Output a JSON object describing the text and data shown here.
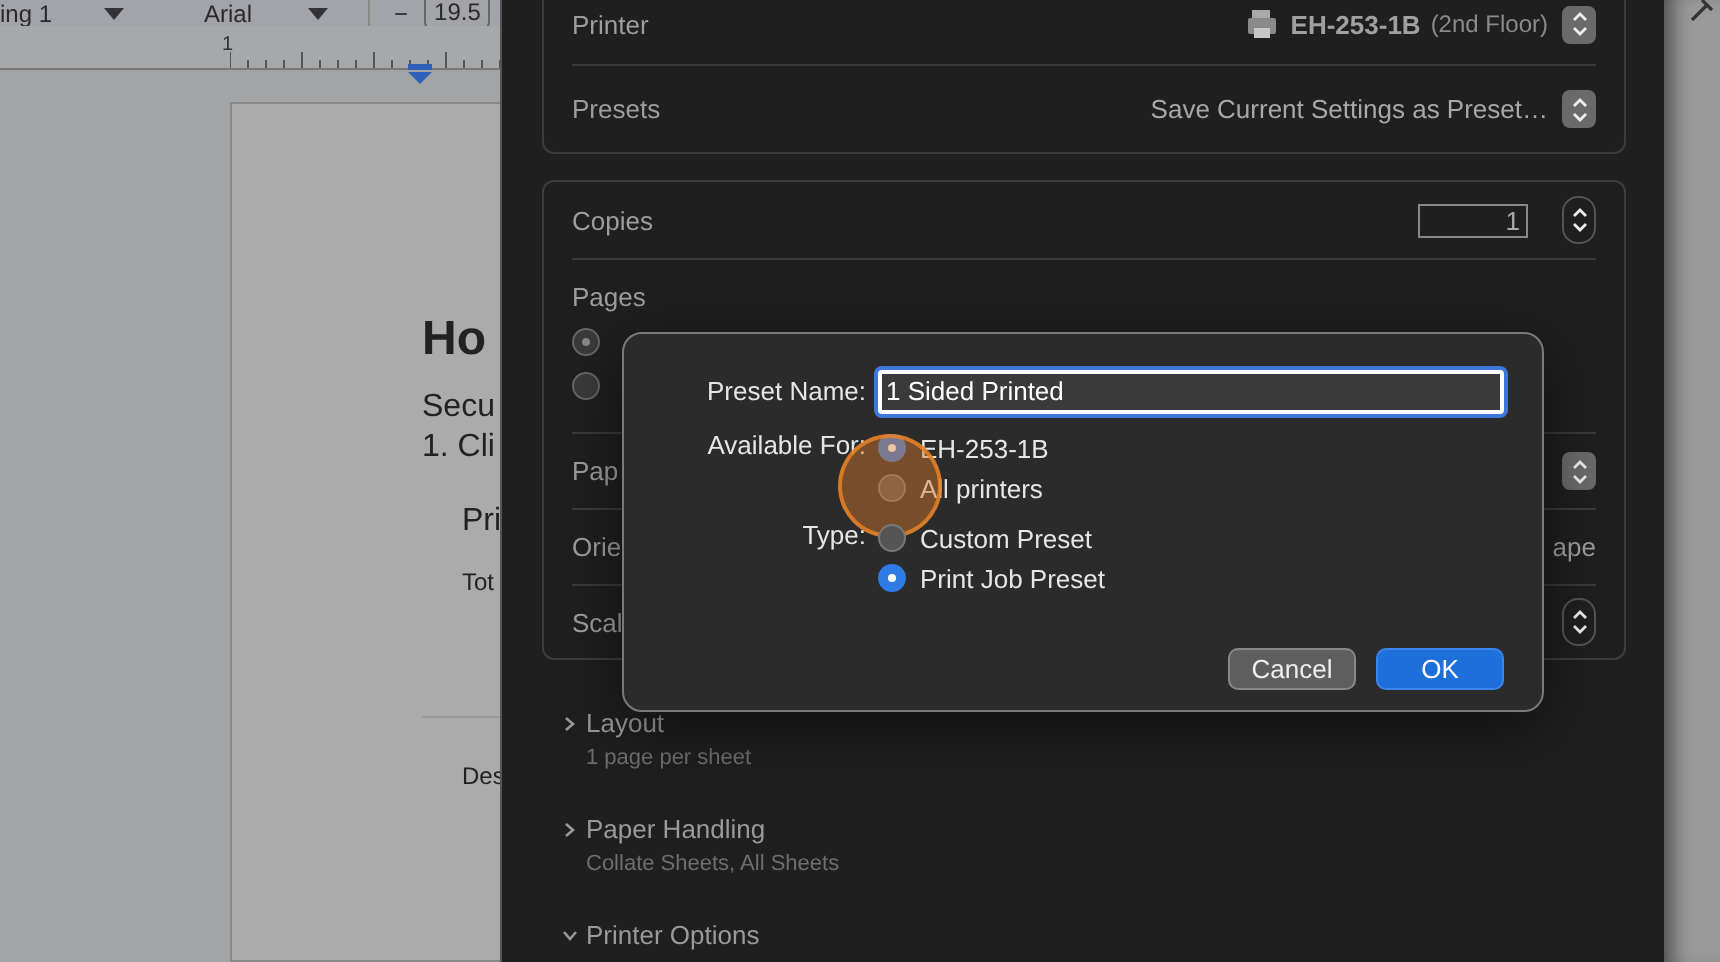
{
  "document": {
    "toolbar": {
      "style": "ing 1",
      "font": "Arial",
      "decrease": "−",
      "size": "19.5"
    },
    "ruler": {
      "mark": "1"
    },
    "texts": [
      {
        "kind": "heading",
        "text": "Ho"
      },
      {
        "kind": "body",
        "text": "Secu"
      },
      {
        "kind": "body",
        "text": "1. Cli"
      },
      {
        "kind": "subheading",
        "text": "Pri"
      },
      {
        "kind": "small",
        "text": "Tot"
      },
      {
        "kind": "rule"
      },
      {
        "kind": "small",
        "text": "Des"
      }
    ]
  },
  "print_sheet": {
    "printer": {
      "label": "Printer",
      "name": "EH-253-1B",
      "location": "(2nd Floor)"
    },
    "presets": {
      "label": "Presets",
      "value": "Save Current Settings as Preset…"
    },
    "copies": {
      "label": "Copies",
      "value": "1"
    },
    "pages": {
      "label": "Pages",
      "options": [
        {
          "selected": true
        },
        {
          "selected": false
        }
      ]
    },
    "rows": [
      {
        "kind": "popup",
        "label": "Pap"
      },
      {
        "kind": "text",
        "label": "Orie",
        "value": "ape"
      },
      {
        "kind": "stepper",
        "label": "Scal"
      }
    ],
    "sections": [
      {
        "title": "Layout",
        "summary": "1 page per sheet",
        "expanded": false
      },
      {
        "title": "Paper Handling",
        "summary": "Collate Sheets, All Sheets",
        "expanded": false
      },
      {
        "title": "Printer Options",
        "expanded": true
      }
    ]
  },
  "preset_dialog": {
    "name_label": "Preset Name:",
    "name_value": "1 Sided Printed",
    "available_label": "Available For:",
    "available_options": [
      {
        "label": "EH-253-1B",
        "selected": true,
        "highlighted": false
      },
      {
        "label": "All printers",
        "selected": false,
        "highlighted": true
      }
    ],
    "type_label": "Type:",
    "type_options": [
      {
        "label": "Custom Preset",
        "selected": false,
        "highlighted": false
      },
      {
        "label": "Print Job Preset",
        "selected": true,
        "highlighted": false
      }
    ],
    "buttons": [
      {
        "label": "Cancel",
        "kind": "secondary"
      },
      {
        "label": "OK",
        "kind": "default"
      }
    ]
  }
}
